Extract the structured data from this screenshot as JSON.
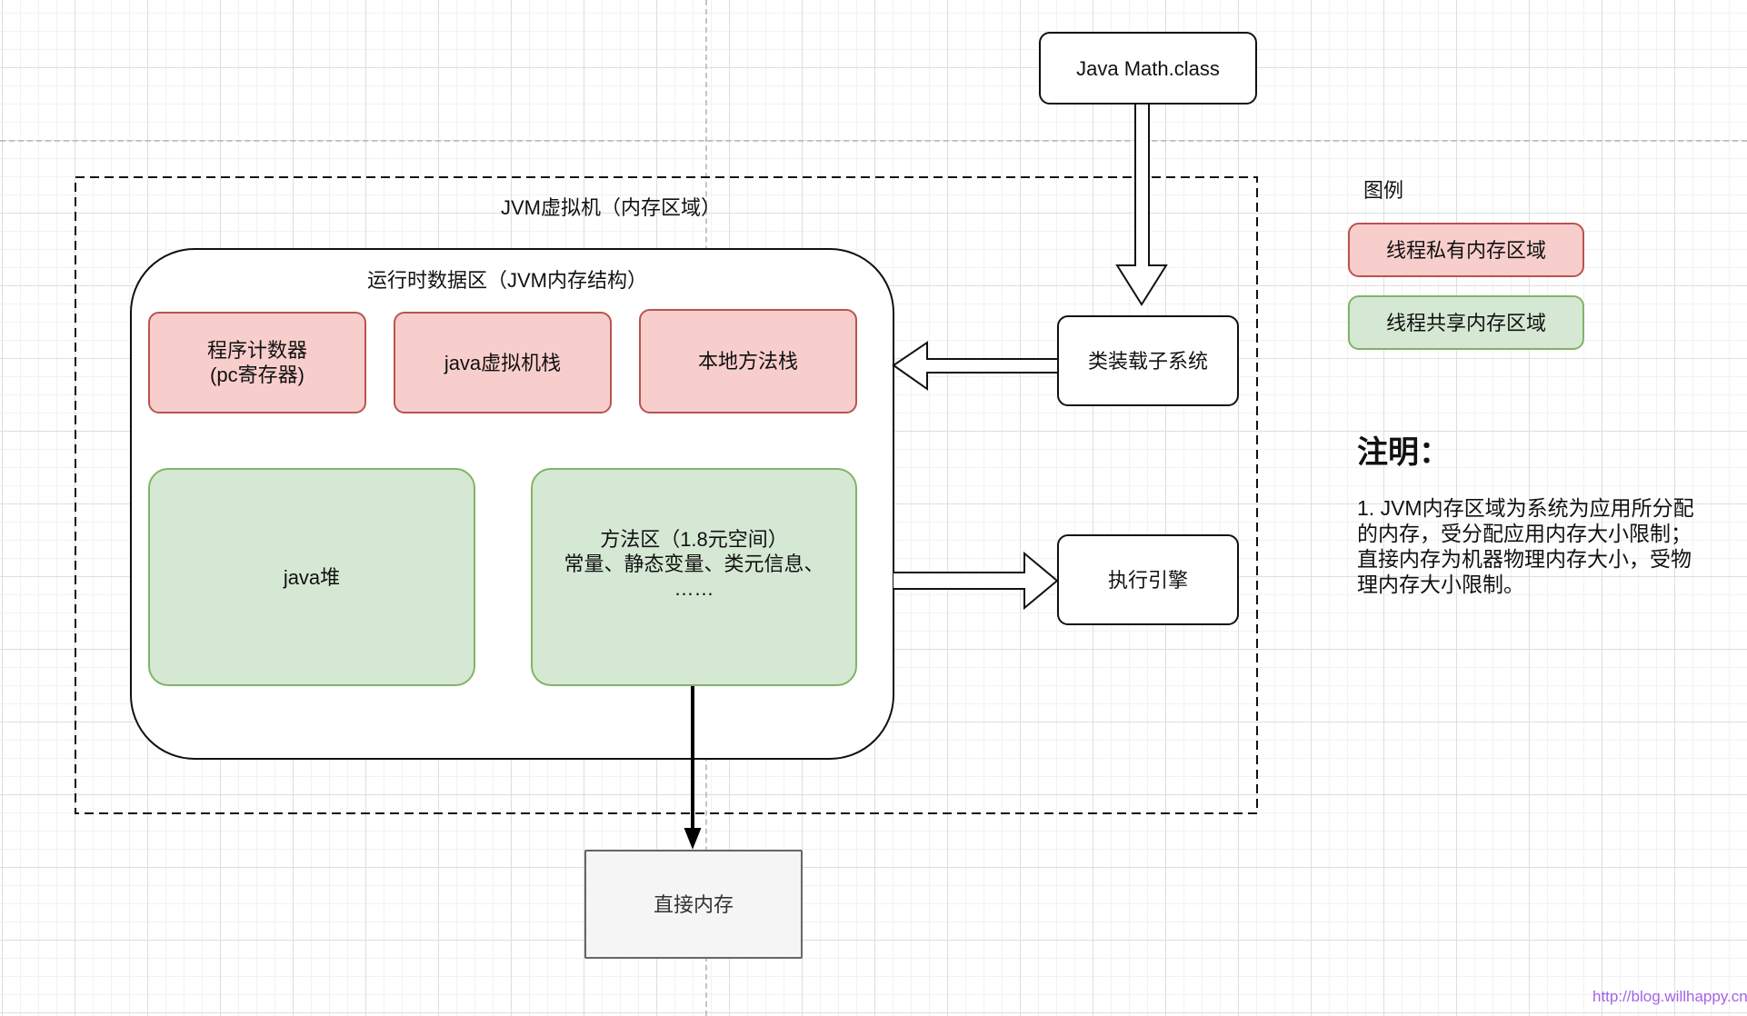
{
  "diagram": {
    "source_box": "Java Math.class",
    "jvm_title": "JVM虚拟机（内存区域）",
    "runtime_title": "运行时数据区（JVM内存结构）",
    "private_areas": [
      {
        "label": "程序计数器\n(pc寄存器)"
      },
      {
        "label": "java虚拟机栈"
      },
      {
        "label": "本地方法栈"
      }
    ],
    "shared_areas": [
      {
        "label": "java堆"
      },
      {
        "label": "方法区（1.8元空间）\n常量、静态变量、类元信息、\n……"
      }
    ],
    "class_loader": "类装载子系统",
    "exec_engine": "执行引擎",
    "direct_memory": "直接内存"
  },
  "legend": {
    "title": "图例",
    "items": [
      {
        "label": "线程私有内存区域",
        "fill": "#f8cecc",
        "stroke": "#b85450"
      },
      {
        "label": "线程共享内存区域",
        "fill": "#d5e8d4",
        "stroke": "#82b366"
      }
    ]
  },
  "notes": {
    "title": "注明：",
    "body": "1. JVM内存区域为系统为应用所分配的内存，受分配应用内存大小限制；直接内存为机器物理内存大小，受物理内存大小限制。"
  },
  "watermark": "http://blog.willhappy.cn"
}
